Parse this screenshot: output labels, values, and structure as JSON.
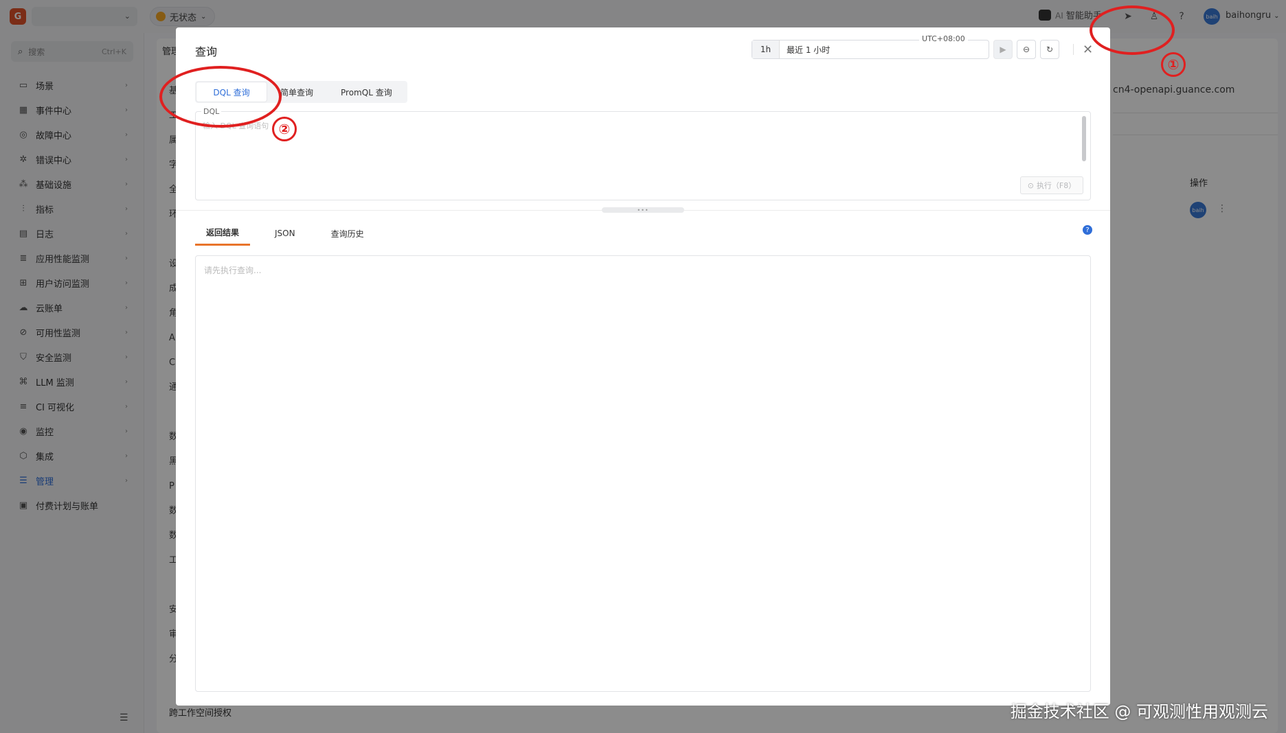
{
  "topbar": {
    "logo_char": "G",
    "status_label": "无状态",
    "ai_prefix": "AI",
    "ai_label": "智能助手",
    "username": "baihongru",
    "avatar_text": "baih"
  },
  "sidebar": {
    "search_placeholder": "搜索",
    "search_shortcut": "Ctrl+K",
    "items": [
      {
        "label": "场景",
        "icon": "screen-icon"
      },
      {
        "label": "事件中心",
        "icon": "calendar-icon"
      },
      {
        "label": "故障中心",
        "icon": "target-icon"
      },
      {
        "label": "错误中心",
        "icon": "bug-icon"
      },
      {
        "label": "基础设施",
        "icon": "nodes-icon"
      },
      {
        "label": "指标",
        "icon": "chart-icon"
      },
      {
        "label": "日志",
        "icon": "log-icon"
      },
      {
        "label": "应用性能监测",
        "icon": "list-icon"
      },
      {
        "label": "用户访问监测",
        "icon": "grid-icon"
      },
      {
        "label": "云账单",
        "icon": "cloud-icon"
      },
      {
        "label": "可用性监测",
        "icon": "ban-icon"
      },
      {
        "label": "安全监测",
        "icon": "shield-icon"
      },
      {
        "label": "LLM 监测",
        "icon": "link-icon"
      },
      {
        "label": "CI 可视化",
        "icon": "stack-icon"
      },
      {
        "label": "监控",
        "icon": "monitor-icon"
      },
      {
        "label": "集成",
        "icon": "hex-icon"
      },
      {
        "label": "管理",
        "icon": "sliders-icon"
      },
      {
        "label": "付费计划与账单",
        "icon": "bill-icon"
      }
    ]
  },
  "background": {
    "title_fragment": "管理",
    "letters": [
      "基",
      "工",
      "属",
      "字",
      "全",
      "环",
      "",
      "设",
      "成",
      "角",
      "A",
      "C",
      "通",
      "",
      "数",
      "黑",
      "P",
      "数",
      "数",
      "工",
      "",
      "安",
      "审",
      "分"
    ],
    "host": "cn4-openapi.guance.com",
    "ops_header": "操作",
    "avatar_text": "baih",
    "bottom_item": "跨工作空间授权"
  },
  "modal": {
    "title": "查询",
    "time_chip": "1h",
    "time_range": "最近 1 小时",
    "timezone": "UTC+08:00",
    "tabs": [
      "DQL 查询",
      "简单查询",
      "PromQL 查询"
    ],
    "editor_label": "DQL",
    "editor_placeholder": "输入 DQL 查询语句",
    "run_button": "执行（F8）",
    "result_tabs": [
      "返回结果",
      "JSON",
      "查询历史"
    ],
    "results_placeholder": "请先执行查询..."
  },
  "annotations": {
    "one": "①",
    "two": "②"
  },
  "watermark": "掘金技术社区 @ 可观测性用观测云",
  "colors": {
    "accent": "#2f6ed8",
    "tab_underline": "#e8742a",
    "annotation": "#e02020"
  }
}
